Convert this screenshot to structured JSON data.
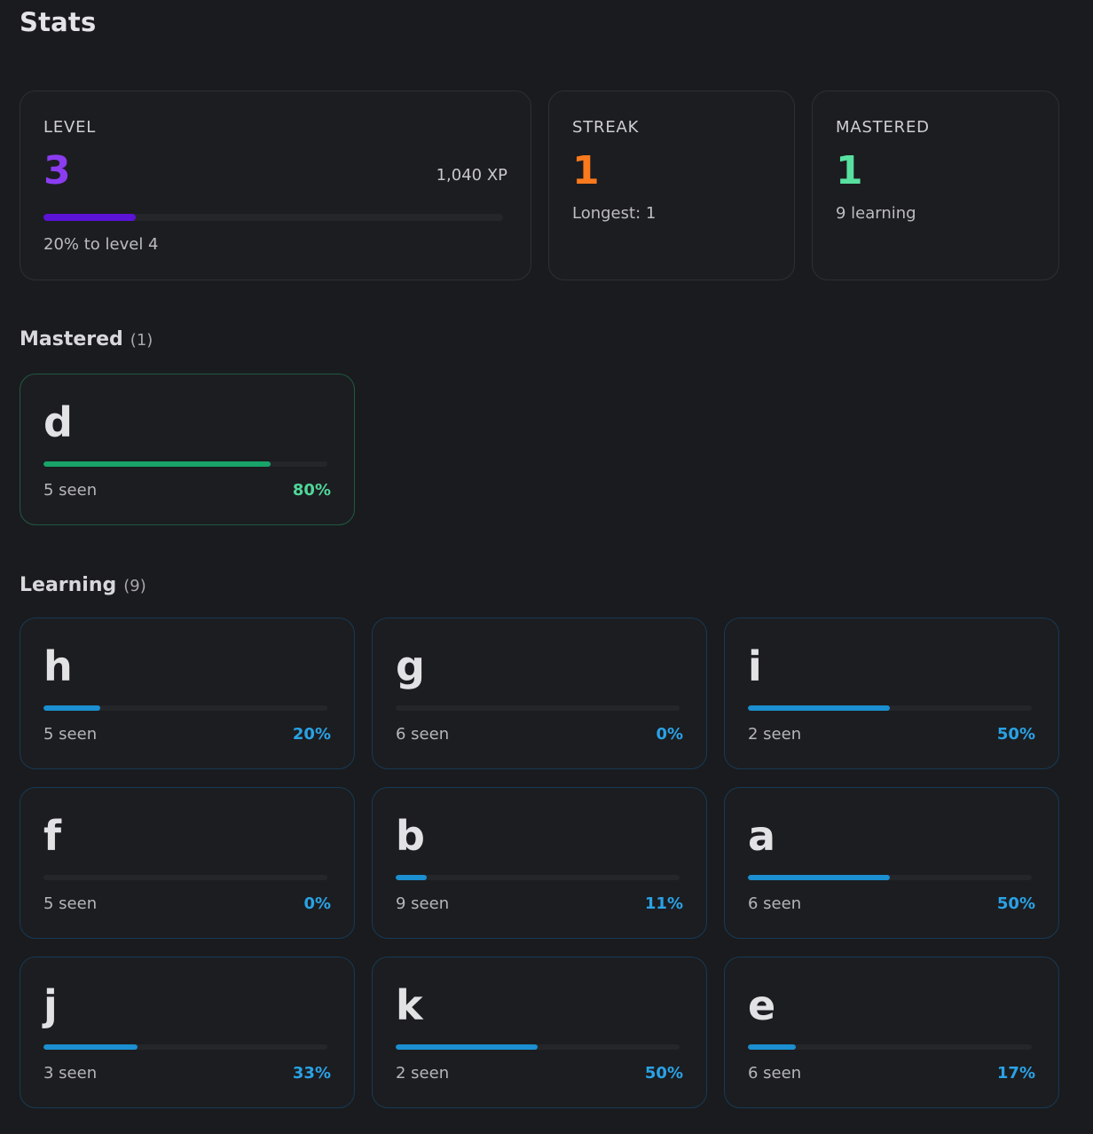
{
  "page": {
    "title": "Stats"
  },
  "stats": {
    "level": {
      "label": "LEVEL",
      "value": "3",
      "xp": "1,040 XP",
      "progress": 20,
      "sub": "20% to level 4"
    },
    "streak": {
      "label": "STREAK",
      "value": "1",
      "sub": "Longest: 1"
    },
    "mastered": {
      "label": "MASTERED",
      "value": "1",
      "sub": "9 learning"
    }
  },
  "colors": {
    "level": "#8b3cf0",
    "streak": "#fb7a1d",
    "mastered": "#58e0a0",
    "mastered_bar": "#19a46a",
    "learning_bar": "#1b8fd1"
  },
  "sections": {
    "mastered": {
      "title": "Mastered",
      "count": "(1)",
      "items": [
        {
          "letter": "d",
          "seen": "5 seen",
          "pct": "80%",
          "progress": 80
        }
      ]
    },
    "learning": {
      "title": "Learning",
      "count": "(9)",
      "items": [
        {
          "letter": "h",
          "seen": "5 seen",
          "pct": "20%",
          "progress": 20
        },
        {
          "letter": "g",
          "seen": "6 seen",
          "pct": "0%",
          "progress": 0
        },
        {
          "letter": "i",
          "seen": "2 seen",
          "pct": "50%",
          "progress": 50
        },
        {
          "letter": "f",
          "seen": "5 seen",
          "pct": "0%",
          "progress": 0
        },
        {
          "letter": "b",
          "seen": "9 seen",
          "pct": "11%",
          "progress": 11
        },
        {
          "letter": "a",
          "seen": "6 seen",
          "pct": "50%",
          "progress": 50
        },
        {
          "letter": "j",
          "seen": "3 seen",
          "pct": "33%",
          "progress": 33
        },
        {
          "letter": "k",
          "seen": "2 seen",
          "pct": "50%",
          "progress": 50
        },
        {
          "letter": "e",
          "seen": "6 seen",
          "pct": "17%",
          "progress": 17
        }
      ]
    }
  }
}
